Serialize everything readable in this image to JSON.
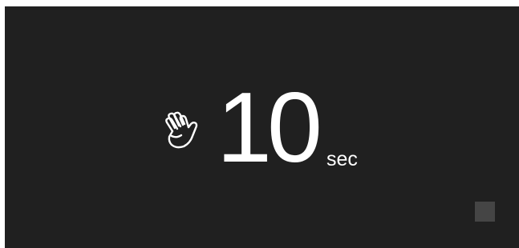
{
  "timer": {
    "value": "10",
    "unit": "sec",
    "icon": "hand-wave-icon"
  },
  "controls": {
    "stop_icon": "stop-square-icon"
  },
  "colors": {
    "background": "#202020",
    "text": "#ffffff",
    "stop_button": "#454545"
  }
}
